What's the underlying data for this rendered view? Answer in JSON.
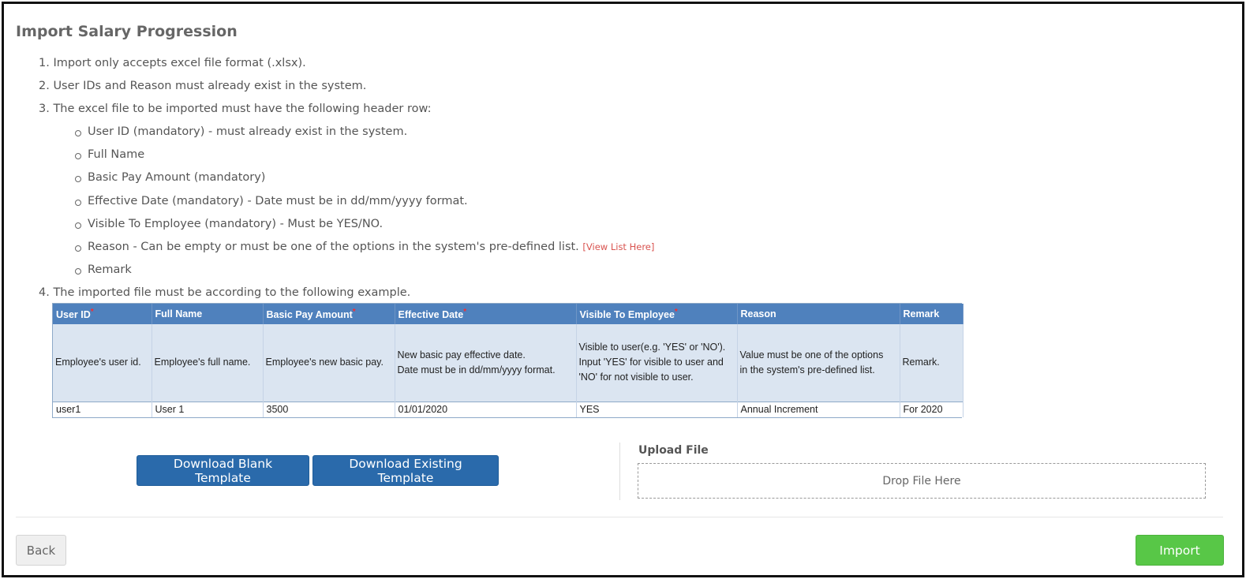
{
  "page": {
    "title": "Import Salary Progression"
  },
  "instructions": {
    "step1": "1. Import only accepts excel file format (.xlsx).",
    "step2": "2. User IDs and Reason must already exist in the system.",
    "step3": "3. The excel file to be imported must have the following header row:",
    "fields": [
      "User ID (mandatory) - must already exist in the system.",
      "Full Name",
      "Basic Pay Amount (mandatory)",
      "Effective Date (mandatory) - Date must be in dd/mm/yyyy format.",
      "Visible To Employee (mandatory) - Must be YES/NO.",
      "Reason - Can be empty or must be one of the options in the system's pre-defined list.",
      "Remark"
    ],
    "view_list_link": "[View List Here]",
    "step4": "4. The imported file must be according to the following example."
  },
  "example_table": {
    "headers": [
      "User ID",
      "Full Name",
      "Basic Pay Amount",
      "Effective Date",
      "Visible To Employee",
      "Reason",
      "Remark"
    ],
    "mandatory_marker": "*",
    "descriptions": [
      "Employee's user id.",
      "Employee's full name.",
      "Employee's new basic pay.",
      "New basic pay effective date.\nDate must be in dd/mm/yyyy format.",
      "Visible to user(e.g. 'YES' or 'NO').\nInput 'YES' for visible to user and\n'NO' for not visible to user.",
      "Value must be one of the options\nin the system's pre-defined list.",
      "Remark."
    ],
    "sample_row": [
      "user1",
      "User 1",
      "3500",
      "01/01/2020",
      "YES",
      "Annual Increment",
      "For 2020"
    ]
  },
  "actions": {
    "download_blank": "Download Blank Template",
    "download_existing": "Download Existing Template",
    "upload_label": "Upload File",
    "drop_text": "Drop File Here",
    "back": "Back",
    "import": "Import"
  },
  "colors": {
    "primary_blue": "#2a6aab",
    "import_green": "#58c747",
    "table_header": "#4f81bd",
    "table_desc_bg": "#dbe5f1",
    "link_red": "#d9534f"
  }
}
